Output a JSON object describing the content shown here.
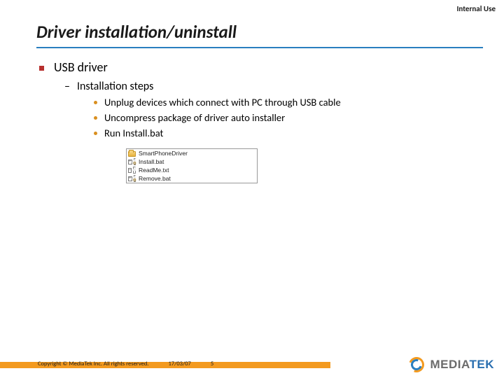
{
  "classification": "Internal Use",
  "title": "Driver installation/uninstall",
  "body": {
    "lvl1": "USB driver",
    "lvl2": "Installation steps",
    "lvl3": [
      "Unplug devices which connect with PC through USB cable",
      "Uncompress package of driver auto installer",
      "Run Install.bat"
    ]
  },
  "filelist": {
    "items": [
      {
        "name": "SmartPhoneDriver",
        "kind": "folder"
      },
      {
        "name": "Install.bat",
        "kind": "batch"
      },
      {
        "name": "ReadMe.txt",
        "kind": "text"
      },
      {
        "name": "Remove.bat",
        "kind": "batch"
      }
    ]
  },
  "footer": {
    "copyright": "Copyright © MediaTek Inc. All rights reserved.",
    "date": "17/03/07",
    "page": "5"
  },
  "logo": {
    "word1": "MEDIA",
    "word2": "TEK"
  }
}
